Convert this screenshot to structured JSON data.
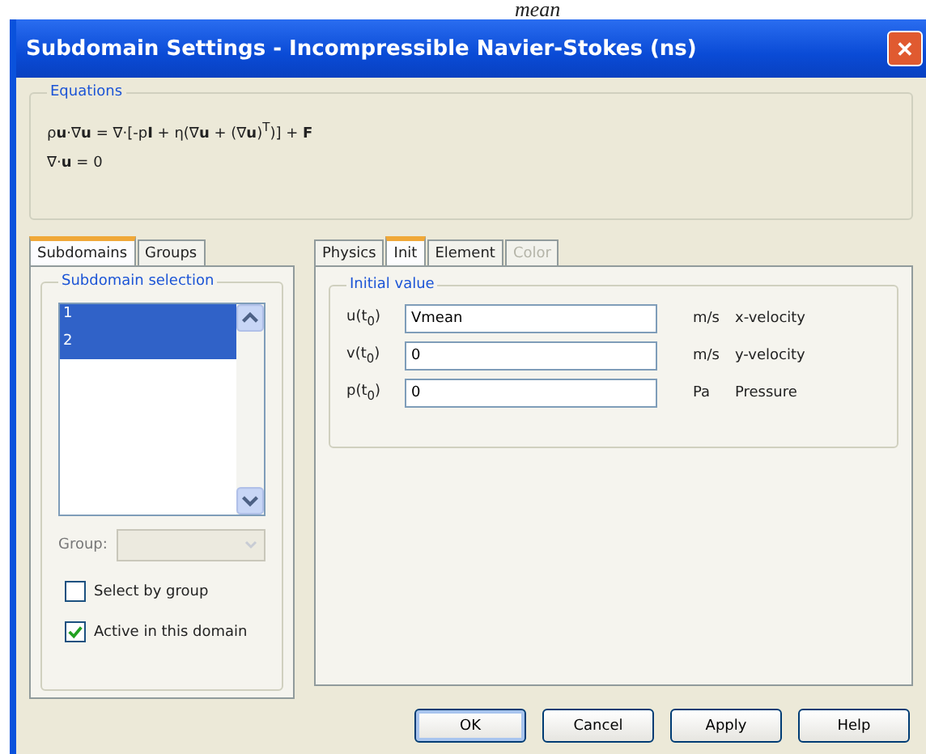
{
  "background_text": "mean",
  "window": {
    "title": "Subdomain Settings - Incompressible Navier-Stokes (ns)",
    "close": "✕"
  },
  "equations": {
    "title": "Equations",
    "lines": [
      "ρ**u**·∇**u** = ∇·[-p**I** + η(∇**u** + (∇**u**)$^{T}$)] + **F**",
      "∇·**u** = 0"
    ]
  },
  "left_tabs": [
    {
      "label": "Subdomains",
      "selected": true
    },
    {
      "label": "Groups",
      "selected": false
    }
  ],
  "subdomain_selection": {
    "title": "Subdomain selection",
    "items": [
      {
        "label": "1",
        "selected": true
      },
      {
        "label": "2",
        "selected": true
      }
    ],
    "group": {
      "label": "Group:",
      "disabled": true
    },
    "checkboxes": [
      {
        "label": "Select by group",
        "checked": false
      },
      {
        "label": "Active in this domain",
        "checked": true
      }
    ]
  },
  "right_tabs": [
    {
      "label": "Physics",
      "selected": false,
      "disabled": false
    },
    {
      "label": "Init",
      "selected": true,
      "disabled": false
    },
    {
      "label": "Element",
      "selected": false,
      "disabled": false
    },
    {
      "label": "Color",
      "selected": false,
      "disabled": true
    }
  ],
  "initial_value": {
    "title": "Initial value",
    "rows": [
      {
        "label": "u(t$_{0}$)",
        "value": "Vmean",
        "unit": "m/s",
        "description": "x-velocity"
      },
      {
        "label": "v(t$_{0}$)",
        "value": "0",
        "unit": "m/s",
        "description": "y-velocity"
      },
      {
        "label": "p(t$_{0}$)",
        "value": "0",
        "unit": "Pa",
        "description": "Pressure"
      }
    ]
  },
  "buttons": [
    "OK",
    "Cancel",
    "Apply",
    "Help"
  ]
}
